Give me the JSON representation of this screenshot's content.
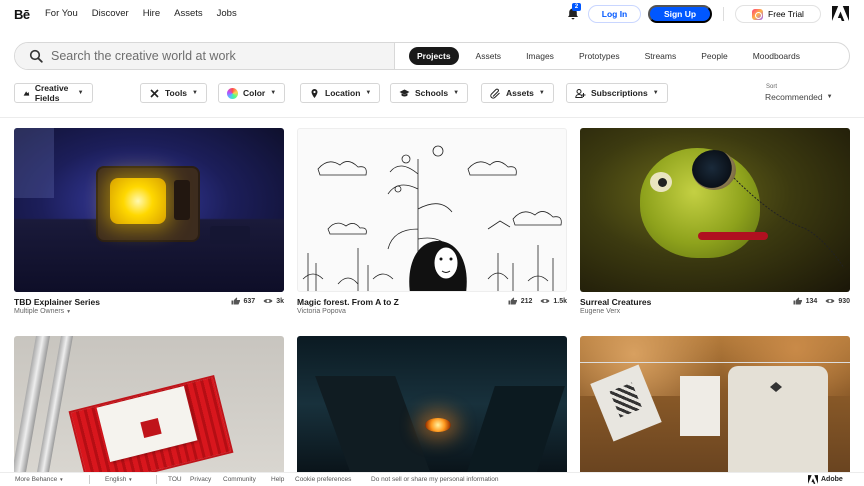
{
  "header": {
    "logo": "Bē",
    "nav": [
      "For You",
      "Discover",
      "Hire",
      "Assets",
      "Jobs"
    ],
    "notification_count": "2",
    "login_label": "Log In",
    "signup_label": "Sign Up",
    "free_trial_label": "Free Trial"
  },
  "search": {
    "placeholder": "Search the creative world at work",
    "tabs": [
      "Projects",
      "Assets",
      "Images",
      "Prototypes",
      "Streams",
      "People",
      "Moodboards"
    ],
    "active_tab": "Projects"
  },
  "filters": {
    "items": [
      {
        "label": "Creative Fields",
        "icon": "creative-fields-icon"
      },
      {
        "label": "Tools",
        "icon": "tools-icon"
      },
      {
        "label": "Color",
        "icon": "color-wheel-icon"
      },
      {
        "label": "Location",
        "icon": "location-pin-icon"
      },
      {
        "label": "Schools",
        "icon": "graduation-cap-icon"
      },
      {
        "label": "Assets",
        "icon": "paperclip-icon"
      },
      {
        "label": "Subscriptions",
        "icon": "subscriptions-icon"
      }
    ],
    "sort_label": "Sort",
    "sort_value": "Recommended"
  },
  "projects": [
    {
      "title": "TBD Explainer Series",
      "owner": "Multiple Owners",
      "owner_dropdown": true,
      "likes": "637",
      "views": "3k"
    },
    {
      "title": "Magic forest. From A to Z",
      "owner": "Victoria Popova",
      "likes": "212",
      "views": "1.5k"
    },
    {
      "title": "Surreal Creatures",
      "owner": "Eugene Verx",
      "likes": "134",
      "views": "930"
    },
    {
      "title": "",
      "owner": "",
      "likes": "",
      "views": ""
    },
    {
      "title": "",
      "owner": "",
      "likes": "",
      "views": ""
    },
    {
      "title": "",
      "owner": "",
      "likes": "",
      "views": ""
    }
  ],
  "footer": {
    "more_behance": "More Behance",
    "language": "English",
    "links": [
      "TOU",
      "Privacy",
      "Community",
      "Help",
      "Cookie preferences",
      "Do not sell or share my personal information"
    ],
    "adobe": "Adobe"
  },
  "colors": {
    "accent": "#0057ff",
    "active_tab_bg": "#191919"
  }
}
